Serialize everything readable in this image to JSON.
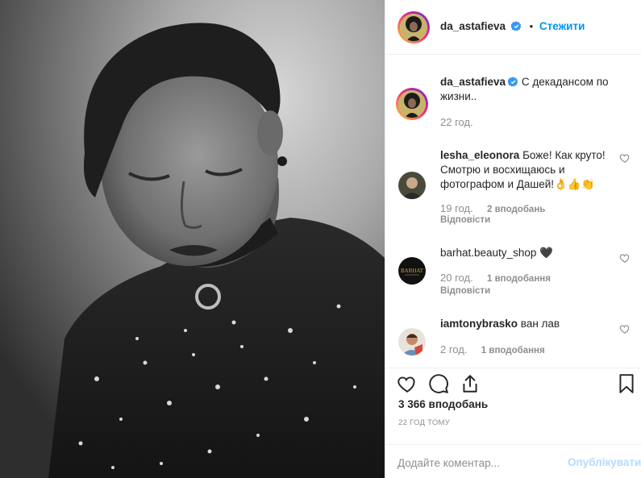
{
  "post": {
    "username": "da_astafieva",
    "follow_label": "Стежити",
    "dot": "•",
    "caption": "С декадансом по жизни..",
    "caption_time": "22 год."
  },
  "comments": [
    {
      "username": "lesha_eleonora",
      "text": "Боже! Как круто! Смотрю и восхищаюсь и фотографом и Дашей!👌👍👏",
      "time": "19 год.",
      "likes": "2 вподобань",
      "reply_label": "Відповісти"
    },
    {
      "username": "barhat.beauty_shop",
      "text": "🖤",
      "time": "20 год.",
      "likes": "1 вподобання",
      "reply_label": "Відповісти"
    },
    {
      "username": "iamtonybrasko",
      "text": "ван лав",
      "time": "2 год.",
      "likes": "1 вподобання"
    }
  ],
  "actions": {
    "likes_count": "3 366 вподобань",
    "timestamp": "22 ГОД ТОМУ",
    "icons": [
      "heart-icon",
      "comment-icon",
      "share-icon",
      "bookmark-icon"
    ]
  },
  "composer": {
    "placeholder": "Додайте коментар...",
    "post_label": "Опублікувати"
  },
  "colors": {
    "accent": "#0095f6",
    "verified": "#3897f0",
    "muted": "#8e8e8e",
    "post_disabled": "#b3dbff",
    "border": "#efefef"
  }
}
